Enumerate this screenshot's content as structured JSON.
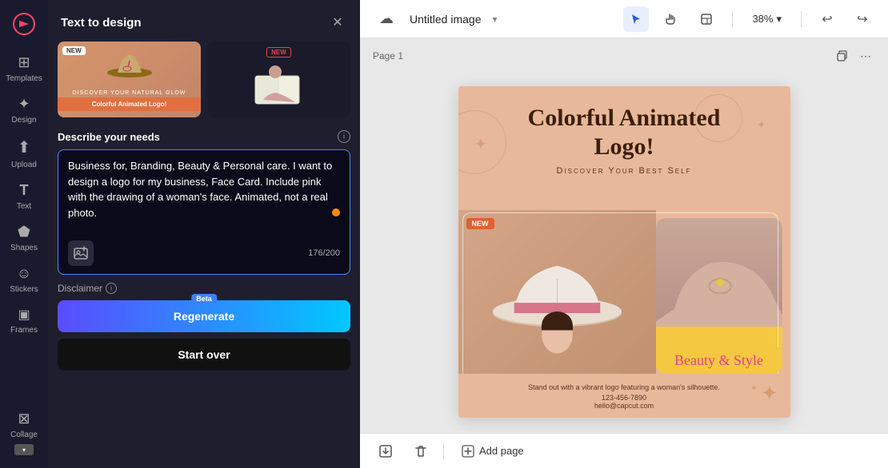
{
  "sidebar": {
    "logo": "✕",
    "items": [
      {
        "id": "templates",
        "label": "Templates",
        "icon": "⊞",
        "active": false
      },
      {
        "id": "design",
        "label": "Design",
        "icon": "✦",
        "active": false
      },
      {
        "id": "upload",
        "label": "Upload",
        "icon": "↑",
        "active": false
      },
      {
        "id": "text",
        "label": "Text",
        "icon": "T",
        "active": false
      },
      {
        "id": "shapes",
        "label": "Shapes",
        "icon": "○",
        "active": false
      },
      {
        "id": "stickers",
        "label": "Stickers",
        "icon": "☺",
        "active": false
      },
      {
        "id": "frames",
        "label": "Frames",
        "icon": "⬜",
        "active": false
      }
    ],
    "bottom_items": [
      {
        "id": "collage",
        "label": "Collage",
        "icon": "⊠"
      }
    ]
  },
  "panel": {
    "title": "Text to design",
    "close_label": "✕",
    "thumbnails": [
      {
        "id": "thumb1",
        "badge": "NEW",
        "label": "Colorful Animated Logo!"
      },
      {
        "id": "thumb2",
        "badge": "NEW"
      }
    ],
    "describe_section": {
      "title": "Describe your needs",
      "info_icon": "i",
      "textarea_value": "Business for, Branding, Beauty & Personal care. I want to design a logo for my business, Face Card. Include pink with the drawing of a woman's face. Animated, not a real photo.",
      "char_count": "176/200",
      "image_upload_icon": "🖼"
    },
    "disclaimer": {
      "label": "Disclaimer",
      "info_icon": "i"
    },
    "buttons": {
      "regenerate": "Regenerate",
      "beta": "Beta",
      "start_over": "Start over"
    }
  },
  "topbar": {
    "cloud_icon": "☁",
    "title": "Untitled image",
    "title_chevron": "▾",
    "tools": [
      {
        "id": "cursor",
        "icon": "↖",
        "active": true
      },
      {
        "id": "hand",
        "icon": "✋",
        "active": false
      },
      {
        "id": "layout",
        "icon": "⊟",
        "active": false
      }
    ],
    "zoom_level": "38%",
    "zoom_chevron": "▾",
    "undo_icon": "↩",
    "redo_icon": "↪"
  },
  "canvas": {
    "page_label": "Page 1",
    "duplicate_icon": "⧉",
    "more_icon": "⋯",
    "design": {
      "main_title": "Colorful Animated\nLogo!",
      "subtitle": "Discover Your Best Self",
      "new_badge": "NEW",
      "beauty_style": "Beauty & Style",
      "tagline": "Stand out with a vibrant logo featuring a woman's silhouette.",
      "phone": "123-456-7890",
      "email": "hello@capcut.com"
    }
  },
  "bottom_bar": {
    "save_icon": "⬇",
    "delete_icon": "🗑",
    "add_page_icon": "⊞",
    "add_page_label": "Add page"
  }
}
